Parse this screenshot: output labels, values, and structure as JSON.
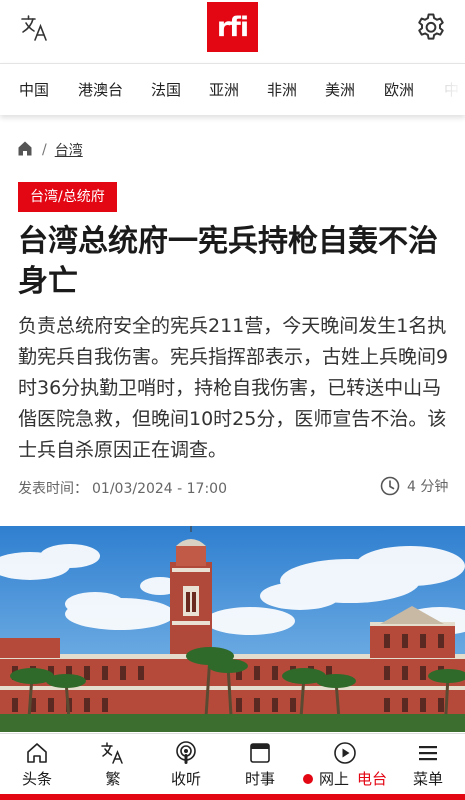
{
  "header": {
    "logo_text": "rfi",
    "brand_color": "#e30613"
  },
  "nav": {
    "items": [
      "中国",
      "港澳台",
      "法国",
      "亚洲",
      "非洲",
      "美洲",
      "欧洲",
      "中"
    ]
  },
  "breadcrumb": {
    "separator": "/",
    "section": "台湾"
  },
  "article": {
    "tag": "台湾/总统府",
    "headline": "台湾总统府一宪兵持枪自轰不治身亡",
    "lede": "负责总统府安全的宪兵211营，今天晚间发生1名执勤宪兵自我伤害。宪兵指挥部表示，古姓上兵晚间9时36分执勤卫哨时，持枪自我伤害，已转送中山马偕医院急救，但晚间10时25分，医师宣告不治。该士兵自杀原因正在调查。",
    "published_label": "发表时间：",
    "published_value": "01/03/2024 - 17:00",
    "read_time": "4 分钟"
  },
  "tabbar": {
    "headlines": "头条",
    "traditional": "繁",
    "listen": "收听",
    "current_affairs": "时事",
    "live_prefix": "网上",
    "live_suffix": "电台",
    "menu": "菜单"
  }
}
